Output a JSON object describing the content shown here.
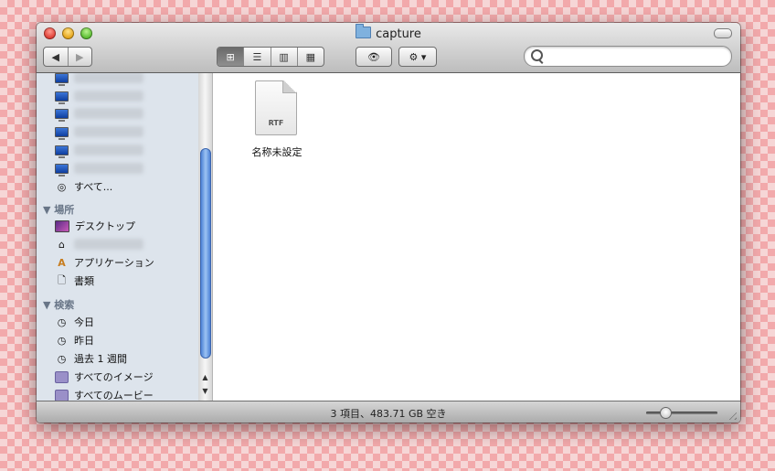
{
  "window": {
    "title": "capture"
  },
  "toolbar": {
    "back_label": "◀",
    "forward_label": "▶",
    "view_icon": "⊞",
    "list_icon": "☰",
    "column_icon": "▥",
    "coverflow_icon": "▦",
    "eye_icon": "👁",
    "gear_icon": "⚙ ▾",
    "search_placeholder": ""
  },
  "sidebar": {
    "shared_all": "すべて...",
    "places_header": "場所",
    "places": [
      "デスクトップ",
      "",
      "アプリケーション",
      "書類"
    ],
    "search_header": "検索",
    "searches": [
      "今日",
      "昨日",
      "過去 1 週間",
      "すべてのイメージ",
      "すべてのムービー"
    ]
  },
  "content": {
    "file_type": "RTF",
    "file_name": "名称未設定"
  },
  "status": {
    "text": "3 項目、483.71 GB 空き"
  },
  "colors": {
    "accent": "#4d82d6",
    "sidebar_bg": "#dde4ec",
    "stripe": "#f2a9ab"
  }
}
